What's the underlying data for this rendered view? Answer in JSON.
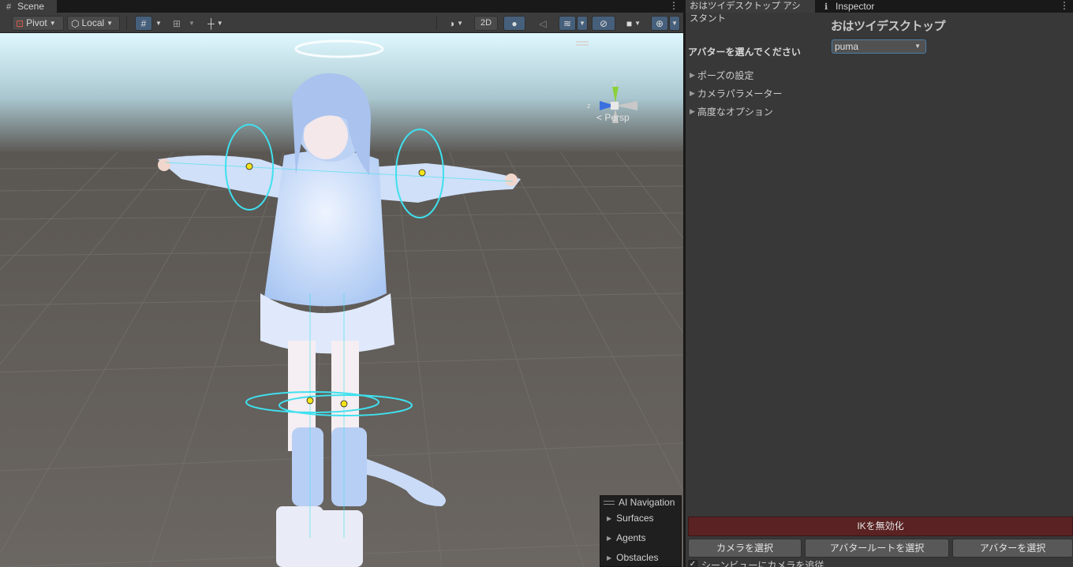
{
  "scene": {
    "tab_label": "Scene",
    "toolbar": {
      "pivot_label": "Pivot",
      "local_label": "Local",
      "mode_2d_label": "2D"
    },
    "gizmo": {
      "axis_y": "y",
      "axis_z": "z",
      "projection_label": "< Persp"
    },
    "ai_navigation": {
      "title": "AI Navigation",
      "items": [
        "Surfaces",
        "Agents",
        "Obstacles"
      ]
    }
  },
  "right_panel": {
    "tabs": [
      "おはツイデスクトップ アシスタント",
      "Inspector"
    ],
    "title": "おはツイデスクトップ",
    "avatar_label": "アバターを選んでください",
    "avatar_select_value": "puma",
    "foldouts": [
      "ポーズの設定",
      "カメラパラメーター",
      "高度なオプション"
    ],
    "ik_button_label": "IKを無効化",
    "bottom_buttons": [
      "カメラを選択",
      "アバタールートを選択",
      "アバターを選択"
    ],
    "follow_camera_label": "シーンビューにカメラを追従",
    "follow_camera_checked": true
  },
  "colors": {
    "ik_button_bg": "#5a2222",
    "toolbar_active": "#46607c",
    "selection_ring": "#3fe0ee"
  }
}
